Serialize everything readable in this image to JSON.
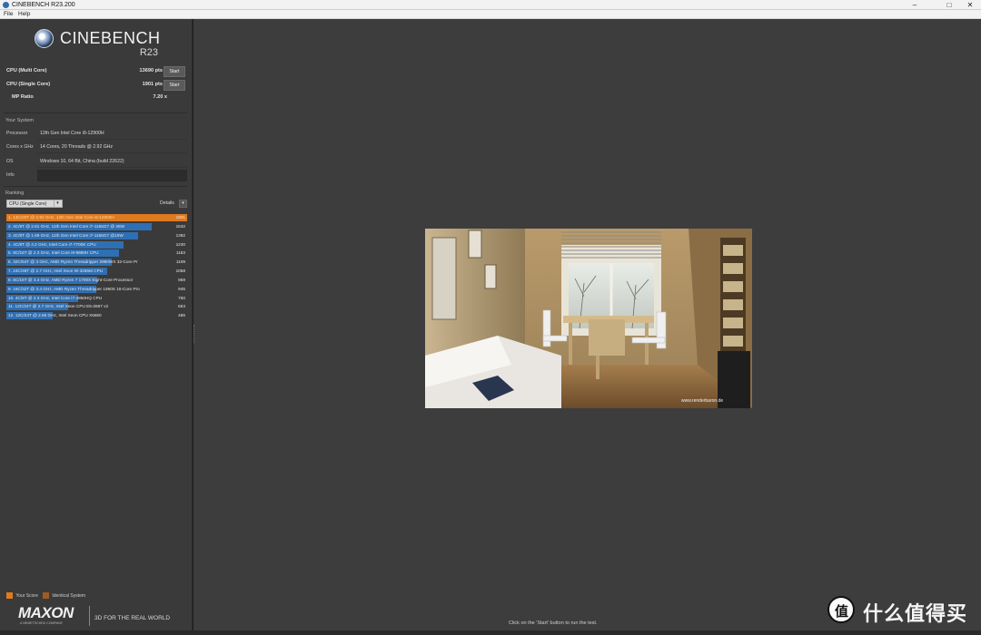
{
  "window": {
    "title": "CINEBENCH R23.200",
    "controls": {
      "minimize": "–",
      "maximize": "□",
      "close": "✕"
    }
  },
  "menu": {
    "file": "File",
    "help": "Help"
  },
  "logo": {
    "name": "CINEBENCH",
    "version": "R23"
  },
  "scores": {
    "multi_label": "CPU (Multi Core)",
    "multi_value": "13690 pts",
    "single_label": "CPU (Single Core)",
    "single_value": "1901 pts",
    "start_label": "Start",
    "mp_label": "MP Ratio",
    "mp_value": "7.20 x"
  },
  "system": {
    "title": "Your System",
    "rows": [
      {
        "key": "Processor",
        "value": "12th Gen Intel Core i9-12900H"
      },
      {
        "key": "Cores x GHz",
        "value": "14 Cores, 20 Threads @ 2.92 GHz"
      },
      {
        "key": "OS",
        "value": "Windows 10, 64 Bit, China (build 22622)"
      },
      {
        "key": "Info",
        "value": ""
      }
    ]
  },
  "ranking": {
    "title": "Ranking",
    "selected": "CPU (Single Core)",
    "details_label": "Details",
    "max_score": 1901,
    "rows": [
      {
        "label": "1. 14C/20T @ 2.92 GHz, 12th Gen Intel Core i9-12900H",
        "score": 1901,
        "highlight": true
      },
      {
        "label": "2. 4C/8T @ 2.81 GHz, 11th Gen Intel Core i7-1165G7 @ 28W",
        "score": 1532
      },
      {
        "label": "3. 4C/8T @ 1.69 GHz, 11th Gen Intel Core i7-1165G7 @15W",
        "score": 1382
      },
      {
        "label": "4. 4C/8T @ 4.2 GHz, Intel Core i7-7700K CPU",
        "score": 1230
      },
      {
        "label": "5. 8C/16T @ 2.3 GHz, Intel Core i9-9880H CPU",
        "score": 1183
      },
      {
        "label": "6. 32C/64T @ 3 GHz, AMD Ryzen Threadripper 2990WX 32-Core Pr",
        "score": 1109
      },
      {
        "label": "7. 24C/48T @ 2.7 GHz, Intel Xeon W-3265M CPU",
        "score": 1058
      },
      {
        "label": "8. 8C/16T @ 3.4 GHz, AMD Ryzen 7 1700X Eight-Core Processor",
        "score": 959
      },
      {
        "label": "9. 16C/32T @ 3.4 GHz, AMD Ryzen Threadripper 1950X 16-Core Pro",
        "score": 945
      },
      {
        "label": "10. 4C/8T @ 2.3 GHz, Intel Core i7-4850HQ CPU",
        "score": 750
      },
      {
        "label": "11. 12C/24T @ 2.7 GHz, Intel Xeon CPU E5-2697 v2",
        "score": 653
      },
      {
        "label": "12. 12C/24T @ 2.66 GHz, Intel Xeon CPU X5650",
        "score": 486
      }
    ]
  },
  "legend": {
    "your_score": "Your Score",
    "identical": "Identical System"
  },
  "colors": {
    "your_score": "#e07a1f",
    "identical": "#a05a22",
    "bar": "#2f6fb3"
  },
  "footer": {
    "brand": "MAXON",
    "brand_sub": "A NEMETSCHEK COMPANY",
    "tagline": "3D FOR THE REAL WORLD"
  },
  "render": {
    "hint": "Click on the 'Start' button to run the test.",
    "watermark": "www.renderbaron.de"
  },
  "watermark": {
    "text": "什么值得买",
    "glyph": "值"
  }
}
